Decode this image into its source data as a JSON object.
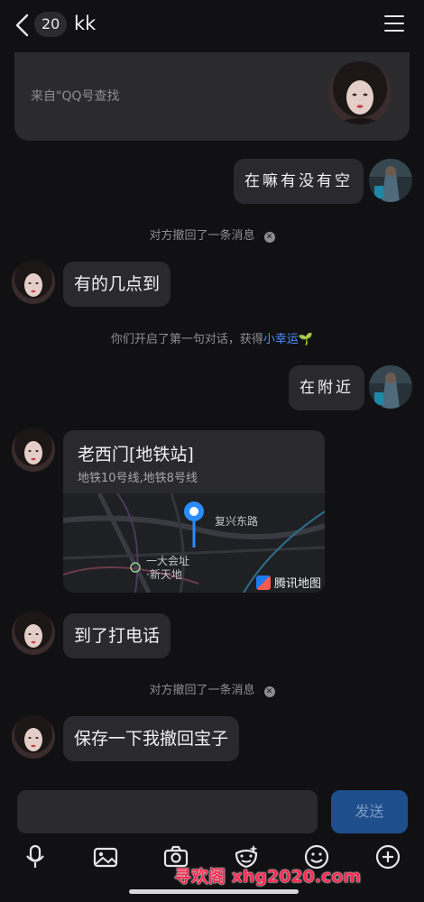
{
  "header": {
    "unread_count": "20",
    "title": "kk"
  },
  "source_card": {
    "text": "来自\"QQ号查找"
  },
  "messages": [
    {
      "type": "out",
      "text": "在嘛有没有空"
    },
    {
      "type": "system",
      "text": "对方撤回了一条消息"
    },
    {
      "type": "in",
      "text": "有的几点到"
    },
    {
      "type": "system",
      "text": "你们开启了第一句对话，获得",
      "link": "小幸运"
    },
    {
      "type": "out",
      "text": "在附近"
    },
    {
      "type": "location",
      "name": "老西门[地铁站]",
      "subtitle": "地铁10号线,地铁8号线",
      "map_labels": [
        "复兴东路",
        "一大会址",
        "·新天地"
      ],
      "map_brand": "腾讯地图"
    },
    {
      "type": "in",
      "text": "到了打电话"
    },
    {
      "type": "system",
      "text": "对方撤回了一条消息"
    },
    {
      "type": "in",
      "text": "保存一下我撤回宝子"
    }
  ],
  "input": {
    "placeholder": "",
    "send_label": "发送"
  },
  "toolbar": [
    "microphone-icon",
    "image-icon",
    "camera-icon",
    "sticker-icon",
    "emoji-icon",
    "plus-icon"
  ],
  "watermark": "寻欢阁 xhg2020.com",
  "colors": {
    "background": "#111113",
    "bubble": "#2a2a2e",
    "link": "#4d90fe",
    "send_button": "#1e4e8b",
    "watermark": "#ff2d55"
  }
}
